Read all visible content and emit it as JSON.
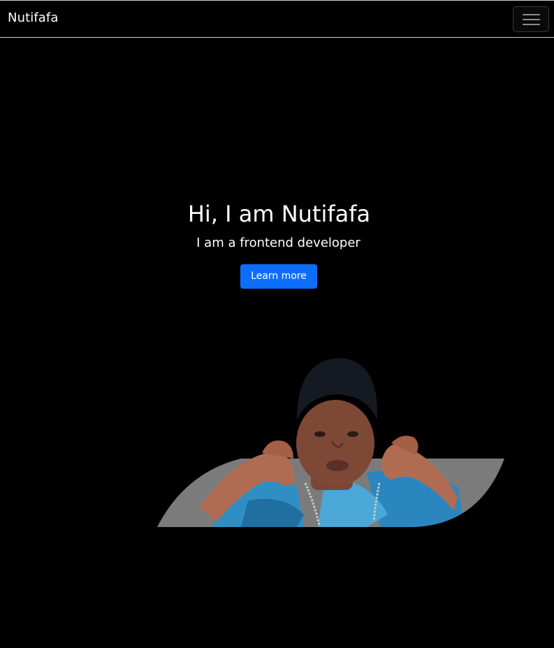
{
  "navbar": {
    "brand": "Nutifafa",
    "toggler_icon": "hamburger-menu-icon"
  },
  "hero": {
    "title": "Hi, I am Nutifafa",
    "subtitle": "I am a frontend developer",
    "button_label": "Learn more"
  },
  "colors": {
    "background": "#000000",
    "text": "#ffffff",
    "primary_button": "#0d6efd",
    "navbar_border": "#cfcfcf"
  }
}
